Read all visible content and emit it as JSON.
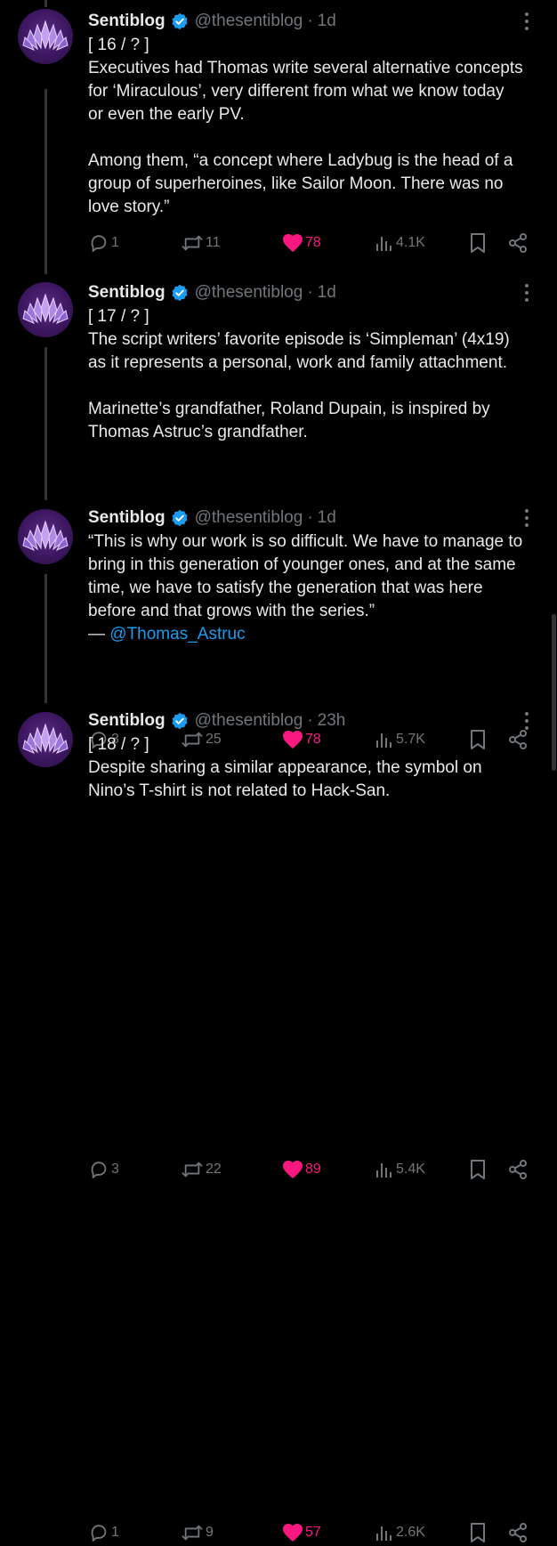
{
  "tweets": [
    {
      "name": "Sentiblog",
      "handle": "@thesentiblog",
      "dot": "·",
      "time": "1d",
      "lines": [
        "[ 16 / ? ]",
        "Executives had Thomas write several alternative concepts",
        "for ‘Miraculous’, very different from what we know today",
        "or even the early PV.",
        "",
        "Among them, “a concept where Ladybug is the head of a",
        "group of superheroines, like Sailor Moon. There was no",
        "love story.”"
      ],
      "replies": "1",
      "reposts": "11",
      "likes": "78",
      "views": "4.1K"
    },
    {
      "name": "Sentiblog",
      "handle": "@thesentiblog",
      "dot": "·",
      "time": "1d",
      "lines": [
        "[ 17 / ? ]",
        "The script writers’ favorite episode is ‘Simpleman’ (4x19)",
        "as it represents a personal, work and family attachment.",
        "",
        "Marinette’s grandfather, Roland Dupain, is inspired by",
        "Thomas Astruc’s grandfather."
      ],
      "replies": "3",
      "reposts": "25",
      "likes": "78",
      "views": "5.7K"
    },
    {
      "name": "Sentiblog",
      "handle": "@thesentiblog",
      "dot": "·",
      "time": "1d",
      "lines": [
        "“This is why our work is so difficult. We have to manage to",
        "bring in this generation of younger ones, and at the same",
        "time, we have to satisfy the generation that was here",
        "before and that grows with the series.”"
      ],
      "attribution_prefix": "— ",
      "mention": "@Thomas_Astruc",
      "replies": "3",
      "reposts": "22",
      "likes": "89",
      "views": "5.4K"
    },
    {
      "name": "Sentiblog",
      "handle": "@thesentiblog",
      "dot": "·",
      "time": "23h",
      "lines": [
        "[ 18 / ? ]",
        "Despite sharing a similar appearance, the symbol on",
        "Nino’s T-shirt is not related to Hack-San."
      ],
      "replies": "1",
      "reposts": "9",
      "likes": "57",
      "views": "2.6K"
    }
  ],
  "colors": {
    "background": "#000000",
    "text": "#e7e9ea",
    "muted": "#71767b",
    "like": "#f91880",
    "link": "#1d9bf0",
    "verified": "#1d9bf0"
  },
  "icons": [
    "reply-icon",
    "repost-icon",
    "like-icon",
    "views-icon",
    "bookmark-icon",
    "share-icon",
    "more-icon",
    "verified-icon"
  ]
}
